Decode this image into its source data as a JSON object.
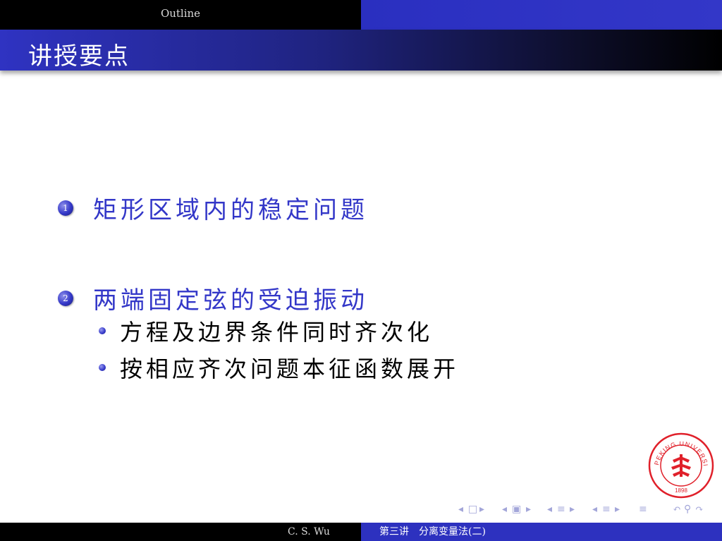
{
  "header": {
    "section": "Outline",
    "title": "讲授要点"
  },
  "items": [
    {
      "number": "1",
      "text": "矩形区域内的稳定问题",
      "subitems": []
    },
    {
      "number": "2",
      "text": "两端固定弦的受迫振动",
      "subitems": [
        "方程及边界条件同时齐次化",
        "按相应齐次问题本征函数展开"
      ]
    }
  ],
  "seal": {
    "label": "PEKING UNIVERSITY",
    "year": "1898",
    "color": "#e0202a"
  },
  "footer": {
    "author": "C. S. Wu",
    "lecture": "第三讲　分离变量法(二)"
  },
  "colors": {
    "accent": "#3337c8",
    "header_bg": "#000000"
  }
}
